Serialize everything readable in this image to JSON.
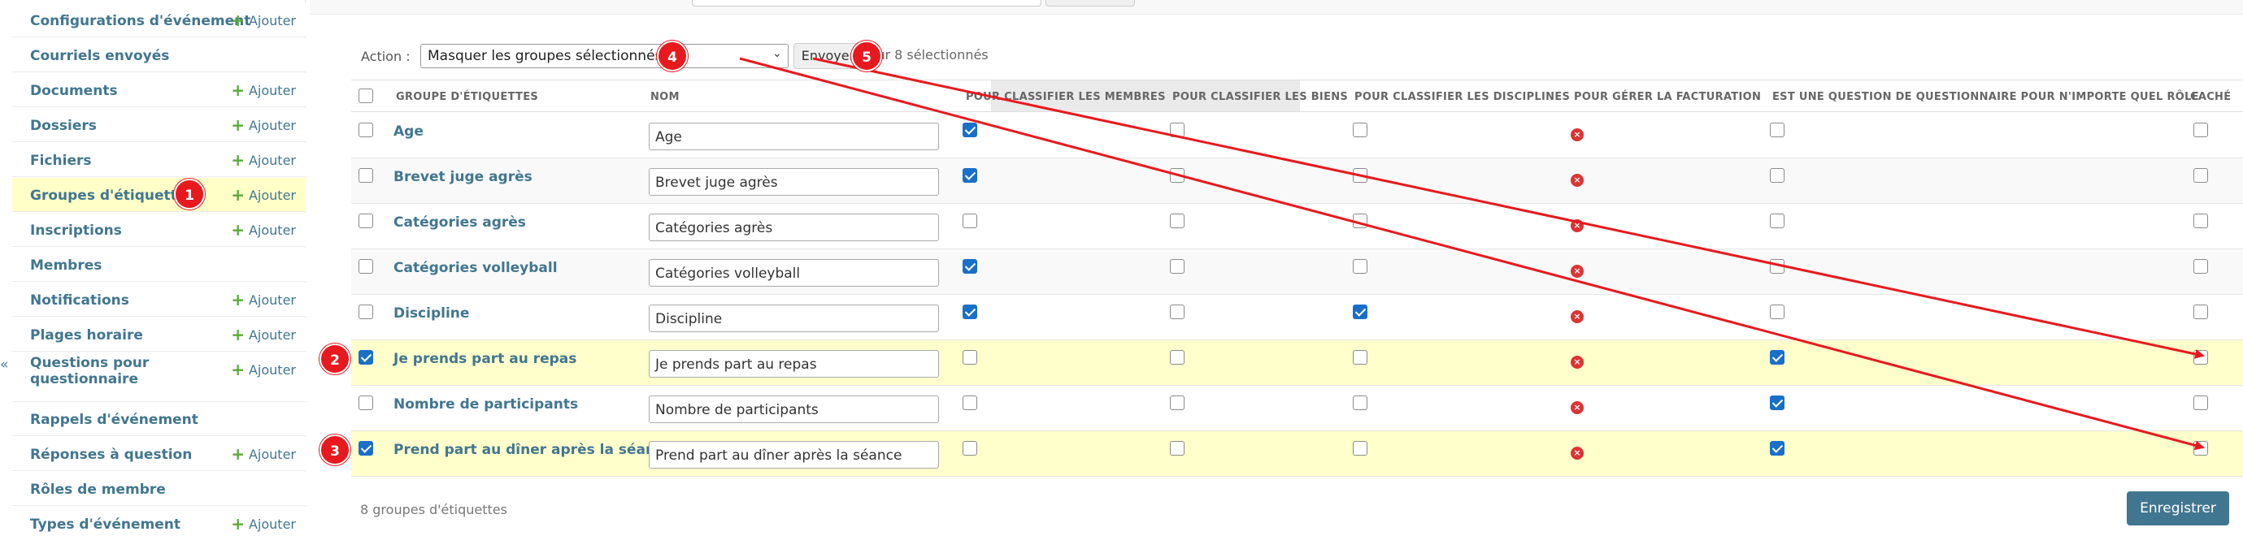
{
  "sidebar": {
    "add_label": "Ajouter",
    "collapse_glyph": "«",
    "items": [
      {
        "label": "Configurations d'événement",
        "add": true
      },
      {
        "label": "Courriels envoyés",
        "add": false
      },
      {
        "label": "Documents",
        "add": true
      },
      {
        "label": "Dossiers",
        "add": true
      },
      {
        "label": "Fichiers",
        "add": true
      },
      {
        "label": "Groupes d'étiquettes",
        "add": true,
        "selected": true
      },
      {
        "label": "Inscriptions",
        "add": true
      },
      {
        "label": "Membres",
        "add": false
      },
      {
        "label": "Notifications",
        "add": true
      },
      {
        "label": "Plages horaire",
        "add": true
      },
      {
        "label": "Questions pour questionnaire",
        "add": true
      },
      {
        "label": "Rappels d'événement",
        "add": false
      },
      {
        "label": "Réponses à question",
        "add": true
      },
      {
        "label": "Rôles de membre",
        "add": false
      },
      {
        "label": "Types d'événement",
        "add": true
      }
    ]
  },
  "actions": {
    "label": "Action :",
    "selected_action": "Masquer les groupes sélectionnés",
    "go_label": "Envoyer",
    "selection_count": "sur 8 sélectionnés"
  },
  "table": {
    "headers": {
      "group": "GROUPE D'ÉTIQUETTES",
      "nom": "NOM",
      "members": "POUR CLASSIFIER LES MEMBRES",
      "goods": "POUR CLASSIFIER LES BIENS",
      "disciplines": "POUR CLASSIFIER LES DISCIPLINES",
      "billing": "POUR GÉRER LA FACTURATION",
      "question": "EST UNE QUESTION DE QUESTIONNAIRE POUR N'IMPORTE QUEL RÔLE",
      "hidden": "CACHÉ"
    },
    "rows": [
      {
        "name": "Age",
        "nom": "Age",
        "selected": false,
        "members": true,
        "goods": false,
        "disciplines": false,
        "question": false,
        "hidden": false
      },
      {
        "name": "Brevet juge agrès",
        "nom": "Brevet juge agrès",
        "selected": false,
        "members": true,
        "goods": false,
        "disciplines": false,
        "question": false,
        "hidden": false
      },
      {
        "name": "Catégories agrès",
        "nom": "Catégories agrès",
        "selected": false,
        "members": false,
        "goods": false,
        "disciplines": false,
        "question": false,
        "hidden": false
      },
      {
        "name": "Catégories volleyball",
        "nom": "Catégories volleyball",
        "selected": false,
        "members": true,
        "goods": false,
        "disciplines": false,
        "question": false,
        "hidden": false
      },
      {
        "name": "Discipline",
        "nom": "Discipline",
        "selected": false,
        "members": true,
        "goods": false,
        "disciplines": true,
        "question": false,
        "hidden": false
      },
      {
        "name": "Je prends part au repas",
        "nom": "Je prends part au repas",
        "selected": true,
        "members": false,
        "goods": false,
        "disciplines": false,
        "question": true,
        "hidden": false
      },
      {
        "name": "Nombre de participants",
        "nom": "Nombre de participants",
        "selected": false,
        "members": false,
        "goods": false,
        "disciplines": false,
        "question": true,
        "hidden": false
      },
      {
        "name": "Prend part au dîner après la séance",
        "nom": "Prend part au dîner après la séance",
        "selected": true,
        "members": false,
        "goods": false,
        "disciplines": false,
        "question": true,
        "hidden": false
      }
    ],
    "billing_icon": "x-circle-icon"
  },
  "footer": {
    "count": "8 groupes d'étiquettes",
    "save_label": "Enregistrer"
  },
  "markers": [
    "1",
    "2",
    "3",
    "4",
    "5"
  ],
  "colors": {
    "link": "#417690",
    "selected_row": "#ffffcc",
    "annotation": "#e8191e",
    "checkbox_on": "#1a6fc9",
    "save_button": "#417690"
  }
}
